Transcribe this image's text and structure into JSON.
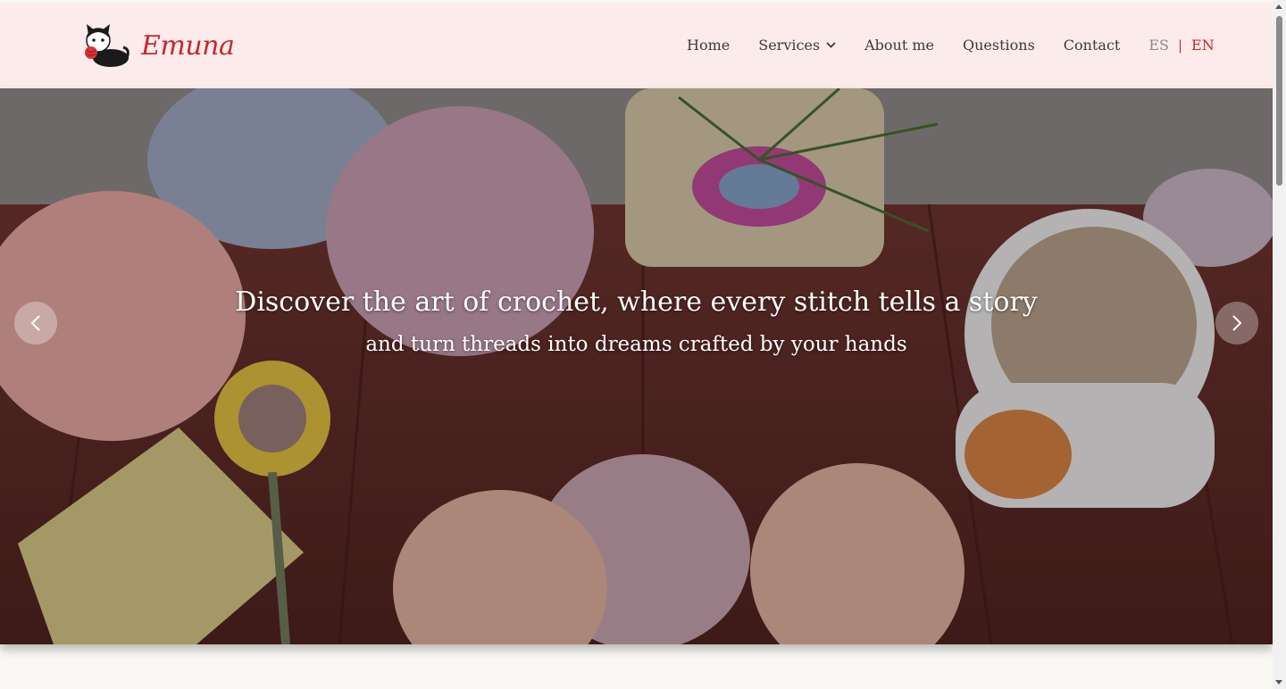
{
  "brand": {
    "name": "Emuna",
    "logo_icon": "cat-with-yarn-icon",
    "color": "#c9262d"
  },
  "nav": {
    "items": [
      {
        "label": "Home"
      },
      {
        "label": "Services"
      },
      {
        "label": "About me"
      },
      {
        "label": "Questions"
      },
      {
        "label": "Contact"
      }
    ],
    "lang_es": "ES",
    "lang_sep": "|",
    "lang_en": "EN"
  },
  "hero": {
    "headline": "Discover the art of crochet, where every stitch tells a story",
    "subheadline": "and turn threads into dreams crafted by your hands",
    "prev_icon": "chevron-left-icon",
    "next_icon": "chevron-right-icon"
  },
  "colors": {
    "header_bg": "#fbeceb",
    "accent": "#c9262d"
  }
}
